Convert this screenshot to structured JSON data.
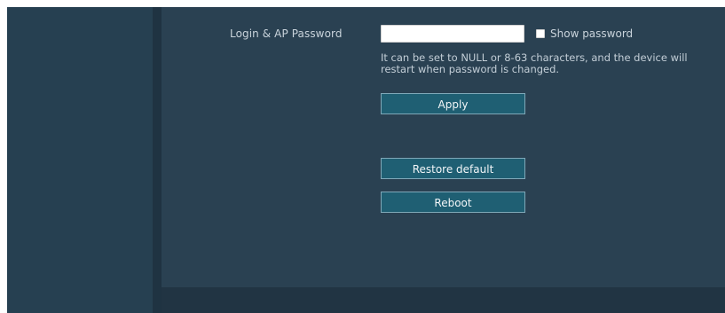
{
  "settings": {
    "password_label": "Login & AP Password",
    "password_value": "",
    "password_placeholder": "",
    "show_password_label": "Show password",
    "show_password_checked": false,
    "hint": "It can be set to NULL or 8-63 characters, and the device will restart when password is changed.",
    "apply_label": "Apply",
    "restore_label": "Restore default",
    "reboot_label": "Reboot"
  },
  "colors": {
    "background": "#223646",
    "sidebar": "#264051",
    "panel": "#2a4152",
    "button": "#1f5f73",
    "button_border": "#7fa8b8"
  }
}
